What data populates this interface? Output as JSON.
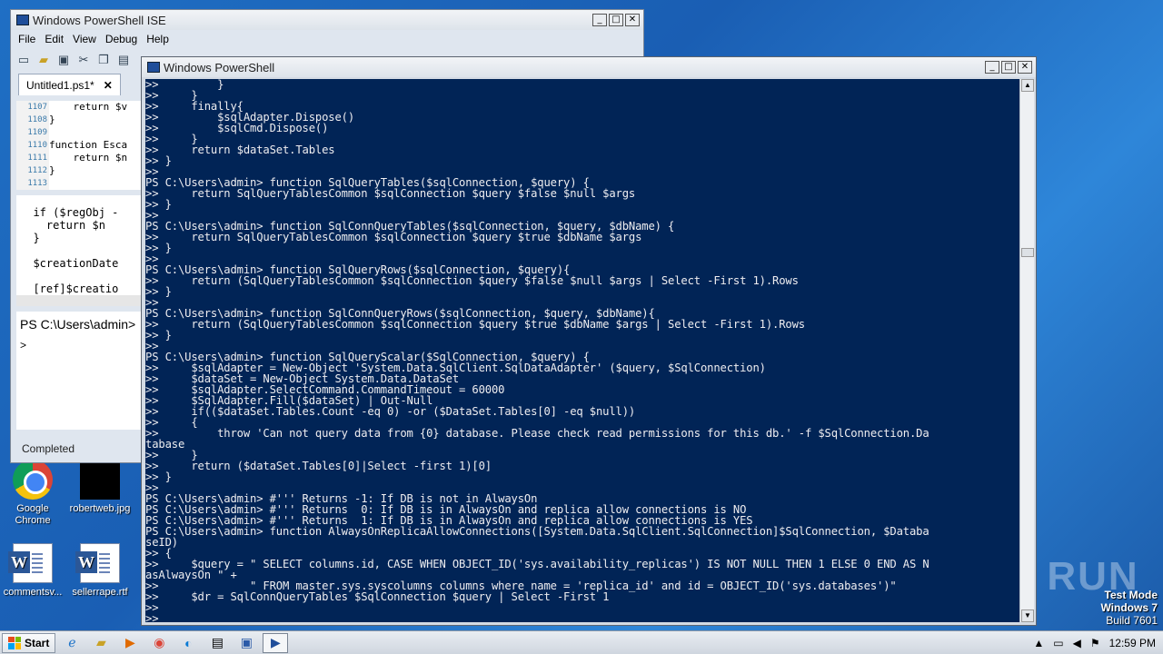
{
  "desktop": {
    "icons": [
      {
        "label": "Google Chrome",
        "icon": "chrome-icon"
      },
      {
        "label": "robertweb.jpg",
        "icon": "image-file-icon"
      },
      {
        "label": "commentsv...",
        "icon": "word-document-icon"
      },
      {
        "label": "sellerrape.rtf",
        "icon": "word-document-icon"
      }
    ],
    "watermark": "ANY RUN",
    "test_mode": {
      "line1": "Test Mode",
      "line2": "Windows 7",
      "line3": "Build 7601"
    }
  },
  "ise": {
    "title": "Windows PowerShell ISE",
    "menu": [
      "File",
      "Edit",
      "View",
      "Debug",
      "Help"
    ],
    "tab_label": "Untitled1.ps1*",
    "line_numbers": [
      "1107",
      "1108",
      "1109",
      "1110",
      "1111",
      "1112",
      "1113"
    ],
    "code_lines": [
      "    return $v",
      "}",
      "",
      "function Esca",
      "    return $n",
      "}",
      ""
    ],
    "pane2_lines": [
      "  if ($regObj -",
      "    return $n",
      "  }",
      "",
      "  $creationDate",
      "",
      "  [ref]$creatio"
    ],
    "console_prompt": "PS C:\\Users\\admin>",
    "console_caret": ">",
    "status": "Completed"
  },
  "powershell": {
    "title": "Windows PowerShell",
    "text": ">>         }\n>>     }\n>>     finally{\n>>         $sqlAdapter.Dispose()\n>>         $sqlCmd.Dispose()\n>>     }\n>>     return $dataSet.Tables\n>> }\n>>\nPS C:\\Users\\admin> function SqlQueryTables($sqlConnection, $query) {\n>>     return SqlQueryTablesCommon $sqlConnection $query $false $null $args\n>> }\n>>\nPS C:\\Users\\admin> function SqlConnQueryTables($sqlConnection, $query, $dbName) {\n>>     return SqlQueryTablesCommon $sqlConnection $query $true $dbName $args\n>> }\n>>\nPS C:\\Users\\admin> function SqlQueryRows($sqlConnection, $query){\n>>     return (SqlQueryTablesCommon $sqlConnection $query $false $null $args | Select -First 1).Rows\n>> }\n>>\nPS C:\\Users\\admin> function SqlConnQueryRows($sqlConnection, $query, $dbName){\n>>     return (SqlQueryTablesCommon $sqlConnection $query $true $dbName $args | Select -First 1).Rows\n>> }\n>>\nPS C:\\Users\\admin> function SqlQueryScalar($SqlConnection, $query) {\n>>     $sqlAdapter = New-Object 'System.Data.SqlClient.SqlDataAdapter' ($query, $SqlConnection)\n>>     $dataSet = New-Object System.Data.DataSet\n>>     $sqlAdapter.SelectCommand.CommandTimeout = 60000\n>>     $SqlAdapter.Fill($dataSet) | Out-Null\n>>     if(($dataSet.Tables.Count -eq 0) -or ($DataSet.Tables[0] -eq $null))\n>>     {\n>>         throw 'Can not query data from {0} database. Please check read permissions for this db.' -f $SqlConnection.Da\ntabase\n>>     }\n>>     return ($dataSet.Tables[0]|Select -first 1)[0]\n>> }\n>>\nPS C:\\Users\\admin> #''' Returns -1: If DB is not in AlwaysOn\nPS C:\\Users\\admin> #''' Returns  0: If DB is in AlwaysOn and replica allow connections is NO\nPS C:\\Users\\admin> #''' Returns  1: If DB is in AlwaysOn and replica allow connections is YES\nPS C:\\Users\\admin> function AlwaysOnReplicaAllowConnections([System.Data.SqlClient.SqlConnection]$SqlConnection, $Databa\nseID)\n>> {\n>>     $query = \" SELECT columns.id, CASE WHEN OBJECT_ID('sys.availability_replicas') IS NOT NULL THEN 1 ELSE 0 END AS N\nasAlwaysOn \" +\n>>              \" FROM master.sys.syscolumns columns where name = 'replica_id' and id = OBJECT_ID('sys.databases')\"\n>>     $dr = SqlConnQueryTables $SqlConnection $query | Select -First 1\n>>\n>>"
  },
  "taskbar": {
    "start_label": "Start",
    "clock": "12:59 PM"
  }
}
